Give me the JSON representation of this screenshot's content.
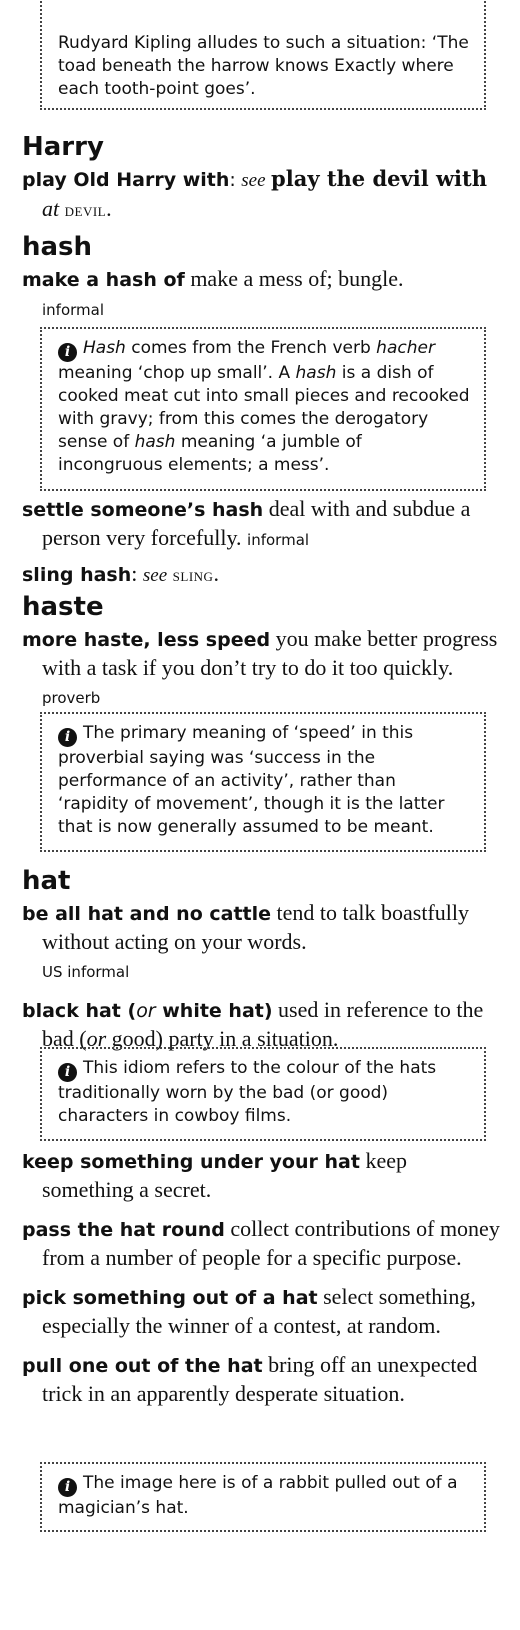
{
  "top_note": {
    "text": "Rudyard Kipling alludes to such a situation: ‘The toad beneath the harrow knows Exactly where each tooth-point goes’."
  },
  "sections": {
    "harry": {
      "headword": "Harry",
      "e1": {
        "phrase": "play Old Harry with",
        "colon": ":",
        "see": "see",
        "xref": "play the devil with",
        "at": "at",
        "xref_sc": "devil",
        "end": "."
      }
    },
    "hash": {
      "headword": "hash",
      "e1": {
        "phrase": "make a hash of",
        "def": "make a mess of; bungle.",
        "label": "informal"
      },
      "note": {
        "i1": "Hash",
        "t1": " comes from the French verb ",
        "i2": "hacher",
        "t2": " meaning ‘chop up small’. A ",
        "i3": "hash",
        "t3": " is a dish of cooked meat cut into small pieces and recooked with gravy; from this comes the derogatory sense of ",
        "i4": "hash",
        "t4": " meaning ‘a jumble of incongruous elements; a mess’."
      },
      "e2": {
        "phrase": "settle someone’s hash",
        "def": "deal with and subdue a person very forcefully.",
        "label": "informal"
      },
      "e3": {
        "phrase": "sling hash",
        "colon": ":",
        "see": "see",
        "xref_sc": "sling",
        "end": "."
      }
    },
    "haste": {
      "headword": "haste",
      "e1": {
        "phrase": "more haste, less speed",
        "def": "you make better progress with a task if you don’t try to do it too quickly.",
        "label": "proverb"
      },
      "note": {
        "text": "The primary meaning of ‘speed’ in this proverbial saying was ‘success in the performance of an activity’, rather than ‘rapidity of movement’, though it is the latter that is now generally assumed to be meant."
      }
    },
    "hat": {
      "headword": "hat",
      "e1": {
        "phrase": "be all hat and no cattle",
        "def": "tend to talk boastfully without acting on your words.",
        "label": "US informal"
      },
      "e2": {
        "phrase_a": "black hat (",
        "or": "or",
        "phrase_b": " white hat)",
        "def_a": "used in reference to the bad (",
        "def_or": "or",
        "def_b": " good) party in a situation."
      },
      "note1": {
        "text": "This idiom refers to the colour of the hats traditionally worn by the bad (or good) characters in cowboy films."
      },
      "e3": {
        "phrase": "keep something under your hat",
        "def": "keep something a secret."
      },
      "e4": {
        "phrase": "pass the hat round",
        "def": "collect contributions of money from a number of people for a specific purpose."
      },
      "e5": {
        "phrase": "pick something out of a hat",
        "def": "select something, especially the winner of a contest, at random."
      },
      "e6": {
        "phrase": "pull one out of the hat",
        "def": "bring off an unexpected trick in an apparently desperate situation."
      },
      "note2": {
        "text": "The image here is of a rabbit pulled out of a magician’s hat."
      }
    }
  },
  "icons": {
    "info": "information-icon"
  }
}
